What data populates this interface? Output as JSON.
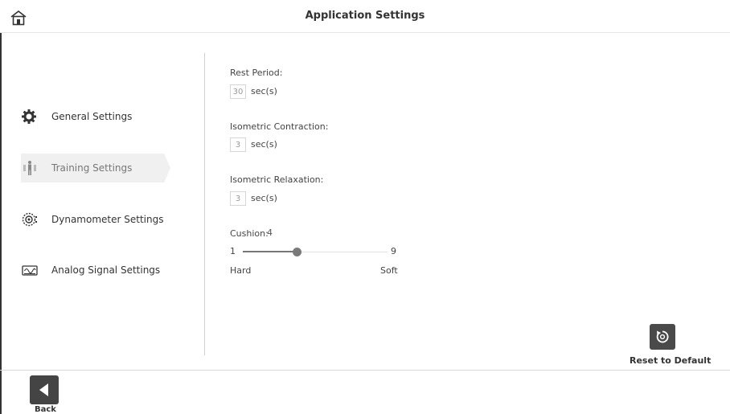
{
  "header": {
    "title": "Application Settings"
  },
  "sidebar": {
    "items": [
      {
        "label": "General Settings",
        "icon": "gear-icon"
      },
      {
        "label": "Training Settings",
        "icon": "training-figure-icon",
        "active": true
      },
      {
        "label": "Dynamometer Settings",
        "icon": "dynamometer-icon"
      },
      {
        "label": "Analog Signal Settings",
        "icon": "analog-signal-icon"
      }
    ]
  },
  "settings": {
    "rest_period": {
      "label": "Rest Period:",
      "value": "30",
      "unit": "sec(s)"
    },
    "isometric_contraction": {
      "label": "Isometric Contraction:",
      "value": "3",
      "unit": "sec(s)"
    },
    "isometric_relaxation": {
      "label": "Isometric Relaxation:",
      "value": "3",
      "unit": "sec(s)"
    },
    "cushion": {
      "label": "Cushion:",
      "value": "4",
      "min": "1",
      "max": "9",
      "min_label": "Hard",
      "max_label": "Soft"
    }
  },
  "actions": {
    "reset_label": "Reset to Default",
    "back_label": "Back"
  },
  "colors": {
    "active_bg": "#f0f0f0",
    "button_bg": "#4a4a4a",
    "slider_thumb": "#7a7a7a"
  }
}
